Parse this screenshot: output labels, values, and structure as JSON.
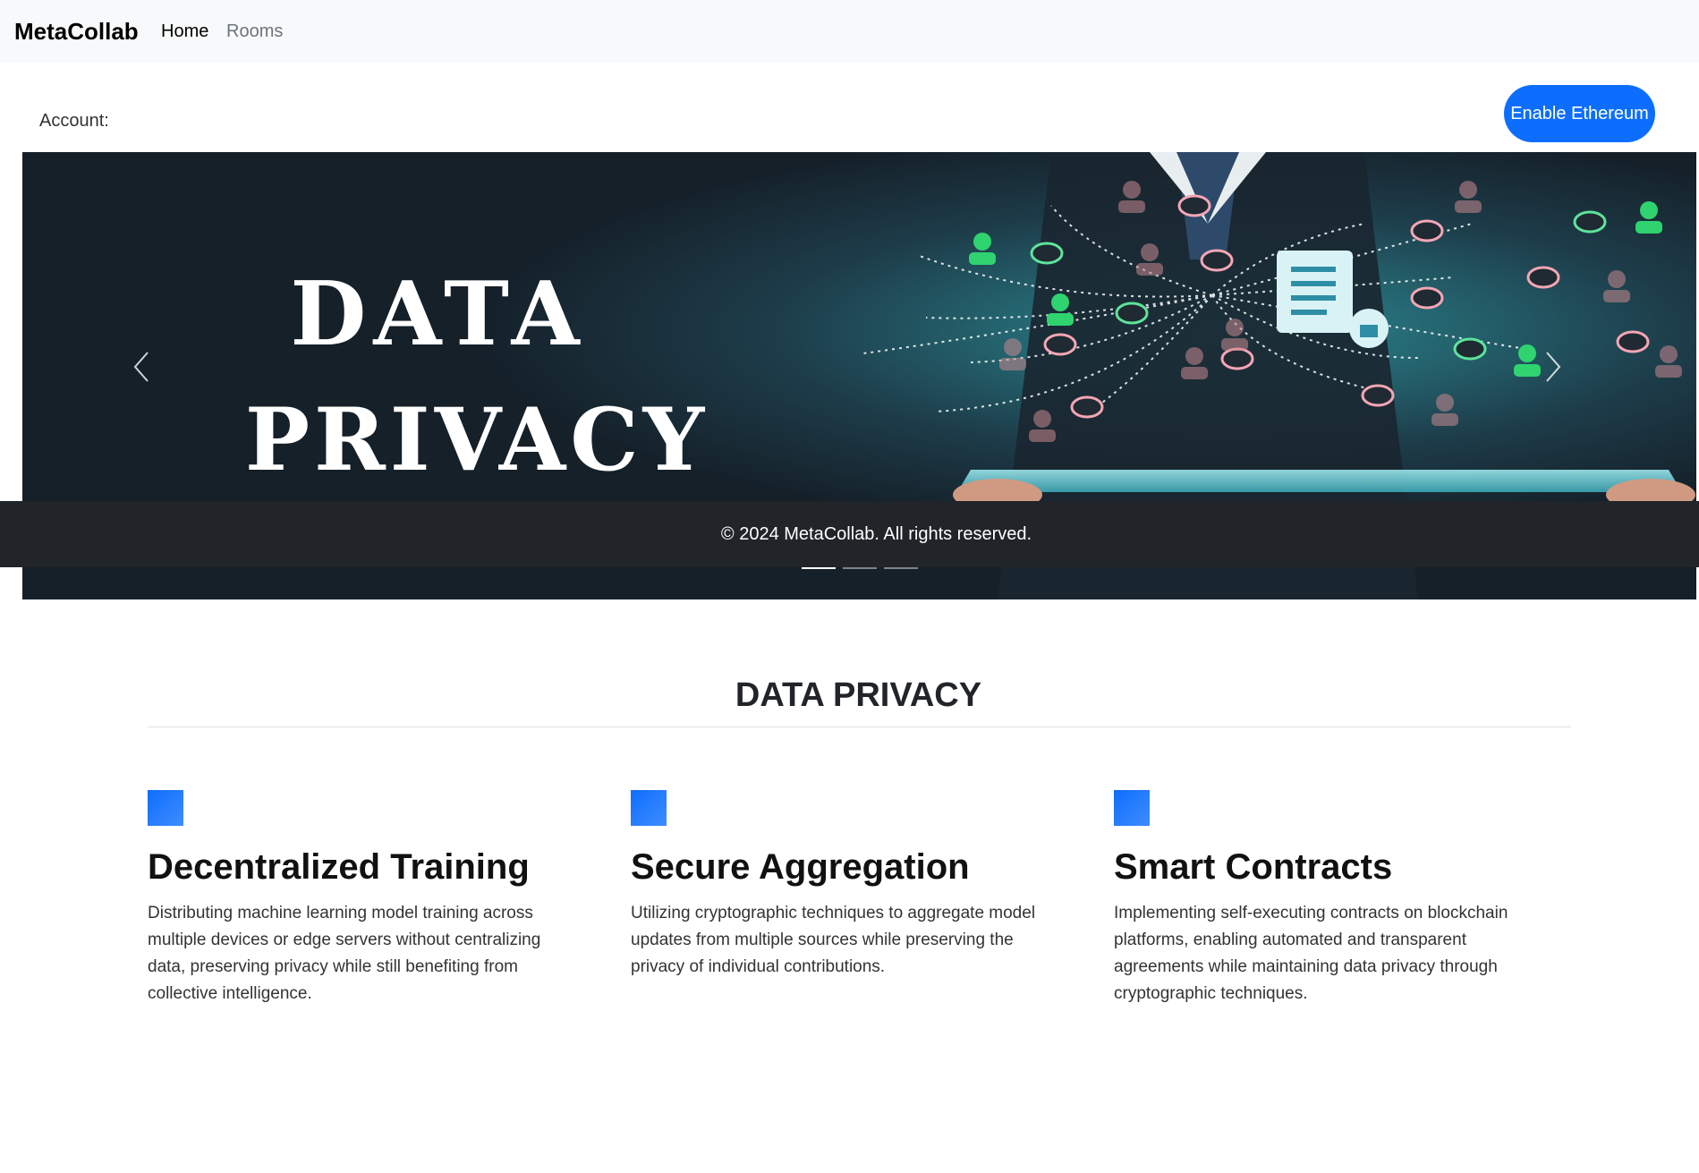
{
  "navbar": {
    "brand": "MetaCollab",
    "links": [
      {
        "label": "Home"
      },
      {
        "label": "Rooms"
      }
    ]
  },
  "account": {
    "label": "Account:",
    "enable_button": "Enable Ethereum"
  },
  "carousel": {
    "slide_text_line1": "DATA",
    "slide_text_line2": "PRIVACY",
    "active_index": 0,
    "slide_count": 3
  },
  "footer": {
    "text": "© 2024 MetaCollab. All rights reserved."
  },
  "section": {
    "title": "DATA PRIVACY",
    "features": [
      {
        "title": "Decentralized Training",
        "text": "Distributing machine learning model training across multiple devices or edge servers without centralizing data, preserving privacy while still benefiting from collective intelligence."
      },
      {
        "title": "Secure Aggregation",
        "text": "Utilizing cryptographic techniques to aggregate model updates from multiple sources while preserving the privacy of individual contributions."
      },
      {
        "title": "Smart Contracts",
        "text": "Implementing self-executing contracts on blockchain platforms, enabling automated and transparent agreements while maintaining data privacy through cryptographic techniques."
      }
    ]
  },
  "colors": {
    "accent": "#0d6efd",
    "footer_bg": "#212529",
    "navbar_bg": "#f8f9fa"
  }
}
